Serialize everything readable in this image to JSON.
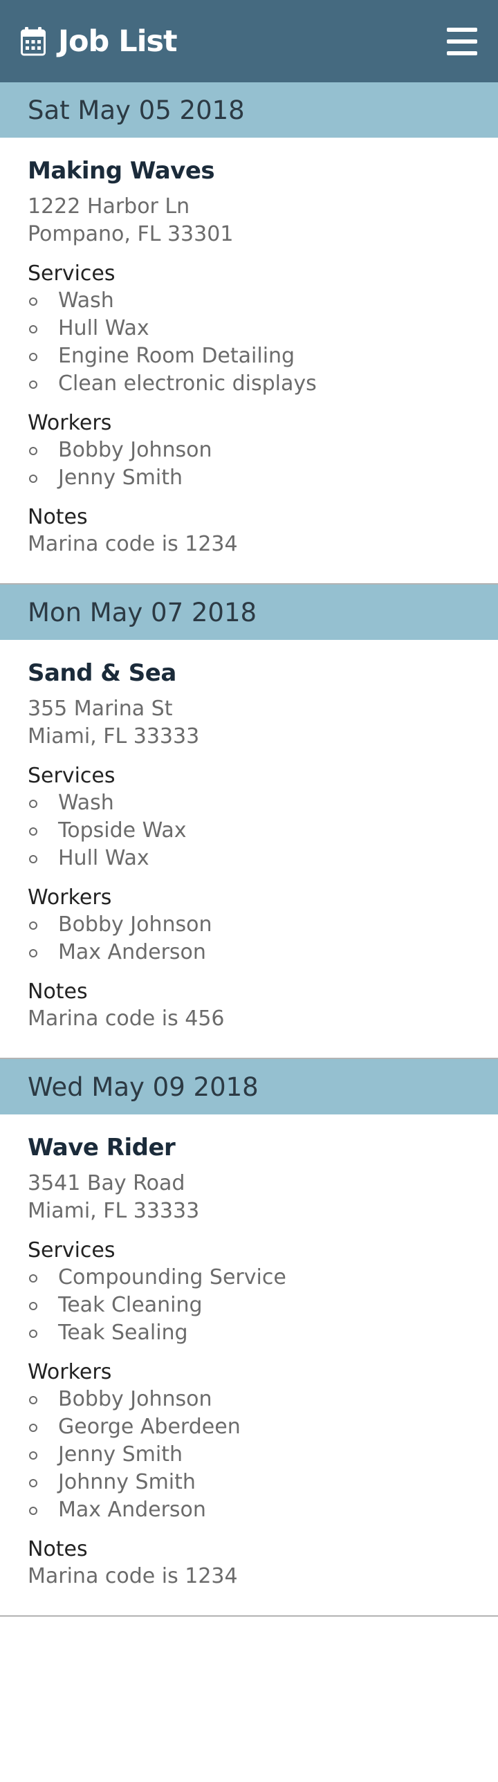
{
  "header": {
    "title": "Job List",
    "icon": "calendar-icon",
    "menu_icon": "hamburger-menu-icon",
    "background_color": "#456a80"
  },
  "colors": {
    "date_bar": "#95c0d0",
    "job_name": "#1b2b3a",
    "muted_text": "#6b6b6b"
  },
  "jobs": [
    {
      "date": "Sat May 05 2018",
      "name": "Making Waves",
      "address_line1": "1222 Harbor Ln",
      "address_line2": "Pompano, FL 33301",
      "services_label": "Services",
      "services": [
        "Wash",
        "Hull Wax",
        "Engine Room Detailing",
        "Clean electronic displays"
      ],
      "workers_label": "Workers",
      "workers": [
        "Bobby Johnson",
        "Jenny Smith"
      ],
      "notes_label": "Notes",
      "notes": "Marina code is 1234"
    },
    {
      "date": "Mon May 07 2018",
      "name": "Sand & Sea",
      "address_line1": "355 Marina St",
      "address_line2": "Miami, FL 33333",
      "services_label": "Services",
      "services": [
        "Wash",
        "Topside Wax",
        "Hull Wax"
      ],
      "workers_label": "Workers",
      "workers": [
        "Bobby Johnson",
        "Max Anderson"
      ],
      "notes_label": "Notes",
      "notes": "Marina code is 456"
    },
    {
      "date": "Wed May 09 2018",
      "name": "Wave Rider",
      "address_line1": "3541 Bay Road",
      "address_line2": "Miami, FL 33333",
      "services_label": "Services",
      "services": [
        "Compounding Service",
        "Teak Cleaning",
        "Teak Sealing"
      ],
      "workers_label": "Workers",
      "workers": [
        "Bobby Johnson",
        "George Aberdeen",
        "Jenny Smith",
        "Johnny Smith",
        "Max Anderson"
      ],
      "notes_label": "Notes",
      "notes": "Marina code is 1234"
    }
  ]
}
